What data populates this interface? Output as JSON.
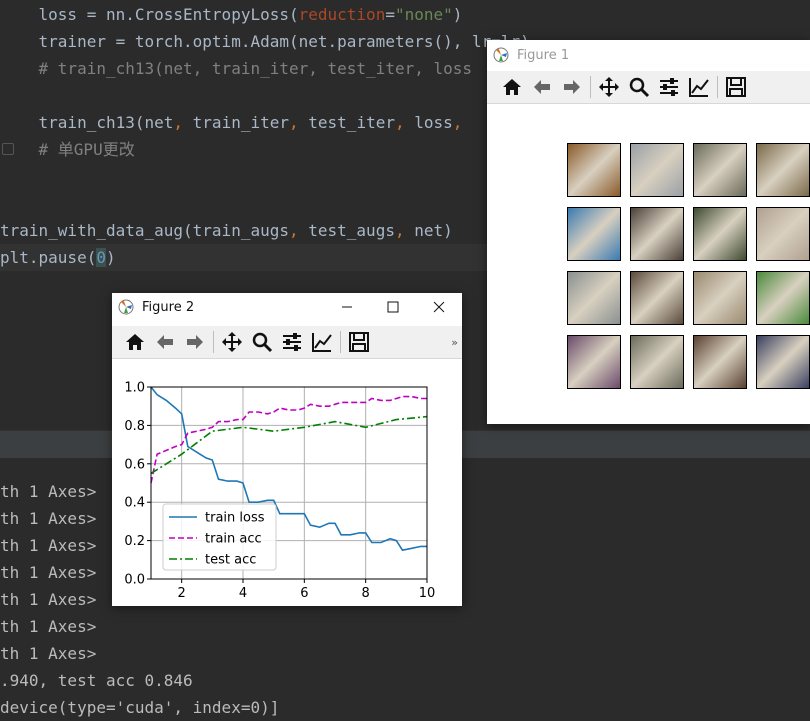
{
  "code": {
    "line1": {
      "a": "    loss = nn.CrossEntropyLoss(",
      "param": "reduction",
      "eq": "=",
      "str": "\"none\"",
      "close": ")"
    },
    "line2": {
      "a": "    trainer = torch.optim.Adam(net.parameters()",
      "rest": ", lr=lr)"
    },
    "line3": "    # train_ch13(net, train_iter, test_iter, loss",
    "line5": {
      "a": "    train_ch13(net",
      "c1": ",",
      "b": " train_iter",
      "c2": ",",
      "c": " test_iter",
      "c3": ",",
      "d": " loss",
      "c4": ","
    },
    "line6": "    # 单GPU更改",
    "line8": {
      "a": "train_with_data_aug(train_augs",
      "c1": ",",
      "b": " test_augs",
      "c2": ",",
      "c": " net)"
    },
    "line9": {
      "a": "plt.pause(",
      "num": "0",
      "b": ")"
    }
  },
  "console": {
    "lines": [
      "th 1 Axes>",
      "th 1 Axes>",
      "th 1 Axes>",
      "th 1 Axes>",
      "th 1 Axes>",
      "th 1 Axes>",
      "th 1 Axes>",
      ".940, test acc 0.846",
      "device(type='cuda', index=0)]"
    ]
  },
  "figure1": {
    "title": "Figure 1",
    "thumb_colors": [
      [
        "#8a5a2a",
        "#9aa0a6",
        "#6a6a5a",
        "#7a6a4a"
      ],
      [
        "#3a7ab0",
        "#4a4038",
        "#3e4a30",
        "#b0a090"
      ],
      [
        "#8a9090",
        "#5a4a3a",
        "#9a8a70",
        "#4a8a3a"
      ],
      [
        "#6a4a6a",
        "#6a6a5a",
        "#5a4030",
        "#3a4060"
      ]
    ]
  },
  "figure2": {
    "title": "Figure 2",
    "more": "»"
  },
  "toolbar_icons": [
    "home-icon",
    "back-arrow-icon",
    "forward-arrow-icon",
    "pan-icon",
    "zoom-icon",
    "configure-subplots-icon",
    "edit-axis-icon",
    "save-icon"
  ],
  "chart_data": {
    "type": "line",
    "xlim": [
      1,
      10
    ],
    "ylim": [
      0.0,
      1.0
    ],
    "xticks": [
      "2",
      "4",
      "6",
      "8",
      "10"
    ],
    "yticks": [
      "0.0",
      "0.2",
      "0.4",
      "0.6",
      "0.8",
      "1.0"
    ],
    "grid": true,
    "legend_position": "lower left",
    "series": [
      {
        "name": "train loss",
        "color": "#1f77b4",
        "style": "solid",
        "x": [
          1.0,
          1.2,
          1.5,
          1.8,
          2.0,
          2.2,
          2.5,
          2.8,
          3.0,
          3.2,
          3.5,
          3.8,
          4.0,
          4.2,
          4.5,
          4.8,
          5.0,
          5.2,
          5.5,
          5.8,
          6.0,
          6.2,
          6.5,
          6.8,
          7.0,
          7.2,
          7.5,
          7.8,
          8.0,
          8.2,
          8.5,
          8.8,
          9.0,
          9.2,
          9.5,
          9.8,
          10.0
        ],
        "y": [
          1.0,
          0.96,
          0.93,
          0.89,
          0.86,
          0.69,
          0.66,
          0.63,
          0.62,
          0.52,
          0.51,
          0.51,
          0.5,
          0.4,
          0.4,
          0.41,
          0.41,
          0.34,
          0.34,
          0.34,
          0.34,
          0.28,
          0.27,
          0.29,
          0.29,
          0.23,
          0.23,
          0.24,
          0.24,
          0.19,
          0.19,
          0.21,
          0.2,
          0.15,
          0.16,
          0.17,
          0.17
        ]
      },
      {
        "name": "train acc",
        "color": "#c000c0",
        "style": "dashed",
        "x": [
          1.0,
          1.2,
          1.5,
          1.8,
          2.0,
          2.2,
          2.5,
          2.8,
          3.0,
          3.2,
          3.5,
          3.8,
          4.0,
          4.2,
          4.5,
          4.8,
          5.0,
          5.2,
          5.5,
          5.8,
          6.0,
          6.2,
          6.5,
          6.8,
          7.0,
          7.2,
          7.5,
          7.8,
          8.0,
          8.2,
          8.5,
          8.8,
          9.0,
          9.2,
          9.5,
          9.8,
          10.0
        ],
        "y": [
          0.5,
          0.65,
          0.67,
          0.69,
          0.7,
          0.76,
          0.77,
          0.78,
          0.79,
          0.82,
          0.82,
          0.83,
          0.83,
          0.87,
          0.87,
          0.86,
          0.87,
          0.89,
          0.88,
          0.88,
          0.89,
          0.91,
          0.9,
          0.9,
          0.91,
          0.92,
          0.92,
          0.92,
          0.92,
          0.94,
          0.93,
          0.93,
          0.94,
          0.95,
          0.95,
          0.94,
          0.94
        ]
      },
      {
        "name": "test acc",
        "color": "#008000",
        "style": "dashdot",
        "x": [
          1,
          2,
          3,
          4,
          5,
          6,
          7,
          8,
          9,
          10
        ],
        "y": [
          0.55,
          0.65,
          0.77,
          0.79,
          0.77,
          0.79,
          0.82,
          0.79,
          0.83,
          0.846
        ]
      }
    ]
  }
}
